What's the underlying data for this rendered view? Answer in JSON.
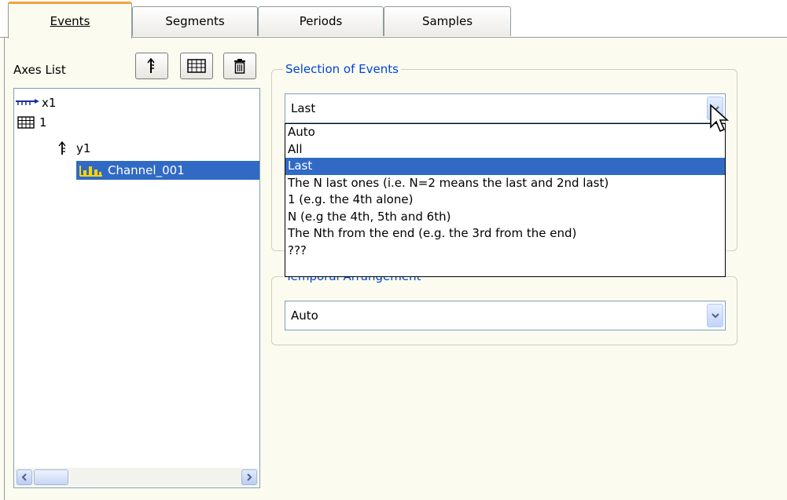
{
  "tabs": [
    {
      "label": "Events",
      "active": true
    },
    {
      "label": "Segments",
      "active": false
    },
    {
      "label": "Periods",
      "active": false
    },
    {
      "label": "Samples",
      "active": false
    }
  ],
  "left_panel": {
    "axes_label": "Axes List",
    "toolbar": [
      "add-axis-icon",
      "add-grid-icon",
      "delete-icon"
    ],
    "tree": [
      {
        "icon": "x-axis-icon",
        "label": "x1",
        "selected": false
      },
      {
        "icon": "grid-icon",
        "label": "1",
        "selected": false
      },
      {
        "icon": "y-axis-icon",
        "label": "y1",
        "selected": false
      },
      {
        "icon": "bar-chart-icon",
        "label": "Channel_001",
        "selected": true
      }
    ]
  },
  "selection_group": {
    "title": "Selection of Events",
    "combo_value": "Last",
    "options": [
      "Auto",
      "All",
      "Last",
      "The N last ones (i.e. N=2 means the last and 2nd last)",
      "1   (e.g. the 4th alone)",
      "N  (e.g the 4th, 5th and 6th)",
      "The Nth from the end (e.g. the 3rd from the end)",
      "???"
    ],
    "selected_option": "Last"
  },
  "temporal_group": {
    "title": "Temporal Arrangement",
    "combo_value": "Auto"
  },
  "colors": {
    "accent": "#316ac5",
    "group_title": "#0046d5",
    "active_tab_top": "#f3a33c"
  }
}
